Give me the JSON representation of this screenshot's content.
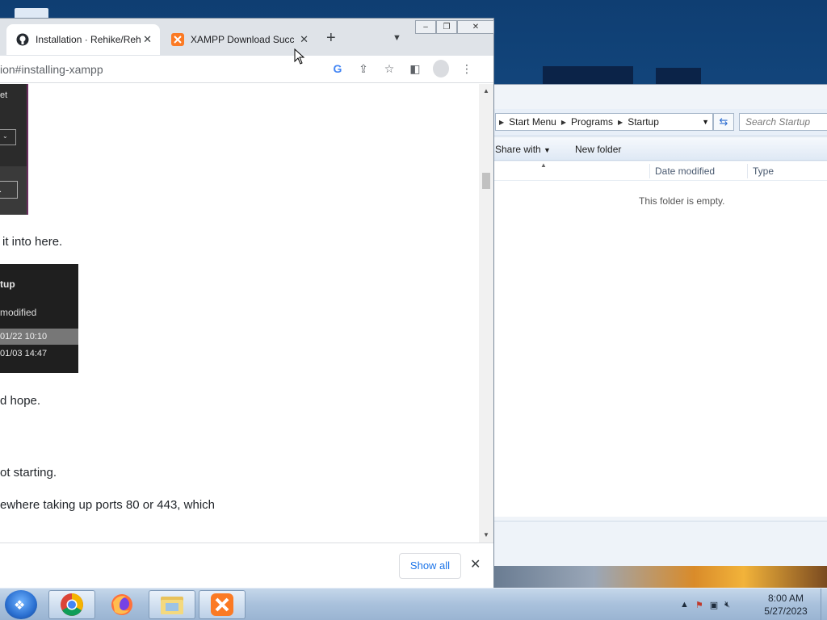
{
  "browser": {
    "tabs": [
      {
        "title": "Installation · Rehike/Rehike",
        "active": true,
        "icon": "github-icon"
      },
      {
        "title": "XAMPP Download Success",
        "active": false,
        "icon": "xampp-icon"
      }
    ],
    "new_tab_symbol": "+",
    "tab_search_symbol": "⌄",
    "url": "ion#installing-xampp",
    "window_buttons": {
      "minimize": "–",
      "restore": "❐",
      "close": "✕"
    }
  },
  "page": {
    "dark_panel": {
      "label": "et",
      "dropdown_arrow": "⌄",
      "button": "."
    },
    "lines": [
      {
        "text": "it into here.",
        "key": "line1"
      },
      {
        "text": "d hope.",
        "key": "line2"
      },
      {
        "text": "ot starting.",
        "key": "line3"
      },
      {
        "text": "ewhere taking up ports 80 or 443, which",
        "key": "line4"
      }
    ],
    "screenshot": {
      "heading": "tup",
      "subheading": "modified",
      "rows": [
        "01/22 10:10",
        "01/03 14:47"
      ]
    }
  },
  "download_bar": {
    "show_all": "Show all",
    "close": "✕"
  },
  "explorer": {
    "breadcrumb": [
      "Start Menu",
      "Programs",
      "Startup"
    ],
    "search_placeholder": "Search Startup",
    "toolbar": {
      "share_with": "Share with",
      "new_folder": "New folder"
    },
    "columns": [
      "Date modified",
      "Type"
    ],
    "empty_message": "This folder is empty."
  },
  "taskbar": {
    "apps": [
      "chrome",
      "firefox",
      "file-explorer",
      "xampp"
    ],
    "clock_time": "8:00 AM",
    "clock_date": "5/27/2023"
  },
  "colors": {
    "accent_blue": "#1a73e8",
    "xampp_orange": "#fb7a24",
    "taskbar": "#a9c1dc"
  }
}
